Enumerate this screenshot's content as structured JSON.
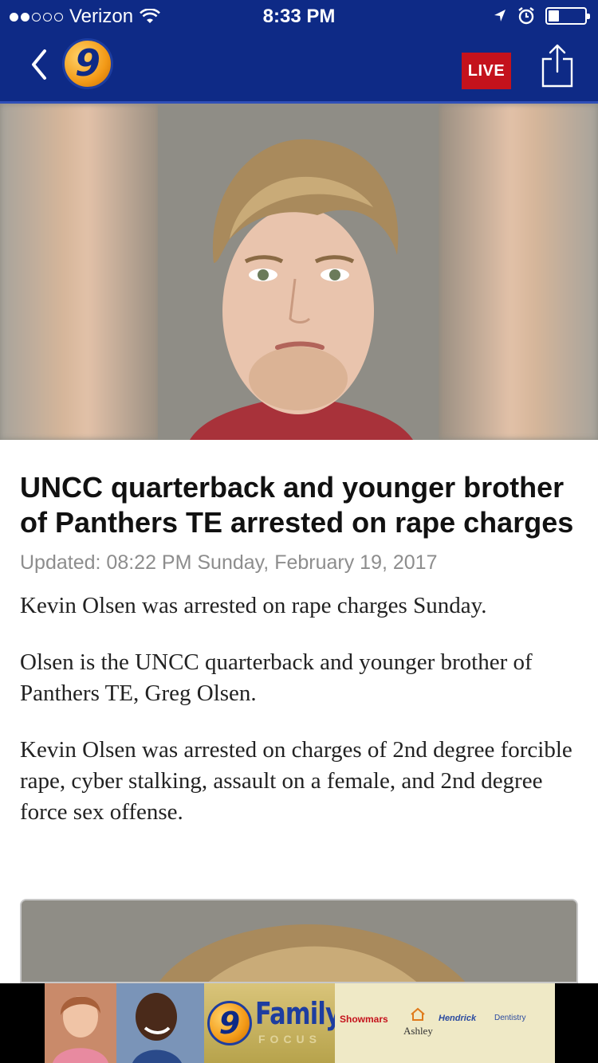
{
  "status_bar": {
    "carrier": "Verizon",
    "time": "8:33 PM",
    "signal_bars_filled": 2,
    "signal_bars_total": 5,
    "battery_level": 0.3
  },
  "nav": {
    "logo_text": "9",
    "live_label": "LIVE"
  },
  "article": {
    "headline": "UNCC quarterback and younger brother of Panthers TE arrested on rape charges",
    "updated": "Updated: 08:22 PM Sunday, February 19, 2017",
    "paragraphs": [
      "Kevin Olsen was arrested on rape charges Sunday.",
      "Olsen is the UNCC quarterback and younger brother of Panthers TE, Greg Olsen.",
      "Kevin Olsen was arrested on charges of 2nd degree forcible rape, cyber stalking, assault on a female, and 2nd degree force sex offense."
    ]
  },
  "ad": {
    "logo_text": "9",
    "brand": "Family",
    "tagline": "FOCUS",
    "sponsors": [
      "Showmars",
      "Ashley",
      "Hendrick",
      "Dentistry"
    ]
  },
  "colors": {
    "nav_background": "#0e2a86",
    "live_red": "#c4121c",
    "logo_orange": "#f39a17"
  }
}
